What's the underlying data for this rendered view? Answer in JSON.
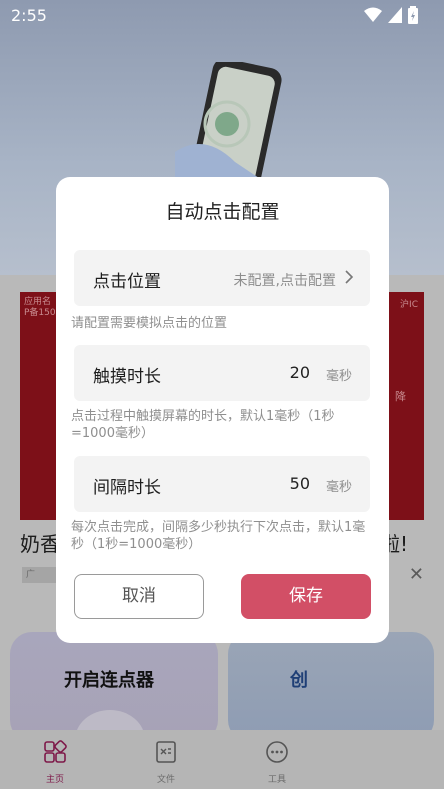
{
  "status_bar": {
    "time": "2:55"
  },
  "background": {
    "ad_small_left": "应用名\nP备150",
    "ad_small_right": "沪IC",
    "ad_right_text": "降",
    "headline_left": "奶香",
    "headline_right": "啦!",
    "ad_tag": "广",
    "card_left_title": "开启连点器",
    "card_right_title": "创"
  },
  "tabs": [
    {
      "label": "主页",
      "icon": "home-grid-icon",
      "active": true
    },
    {
      "label": "文件",
      "icon": "file-icon",
      "active": false
    },
    {
      "label": "工具",
      "icon": "more-dots-icon",
      "active": false
    }
  ],
  "dialog": {
    "title": "自动点击配置",
    "position_row": {
      "label": "点击位置",
      "value": "未配置,点击配置"
    },
    "position_hint": "请配置需要模拟点击的位置",
    "touch_row": {
      "label": "触摸时长",
      "value": "20",
      "unit": "毫秒"
    },
    "touch_hint": "点击过程中触摸屏幕的时长，默认1毫秒（1秒=1000毫秒）",
    "interval_row": {
      "label": "间隔时长",
      "value": "50",
      "unit": "毫秒"
    },
    "interval_hint": "每次点击完成，间隔多少秒执行下次点击，默认1毫秒（1秒=1000毫秒）",
    "cancel_label": "取消",
    "save_label": "保存"
  },
  "colors": {
    "accent": "#d24f66",
    "dialog_bg": "#ffffff",
    "row_bg": "#f3f3f3"
  }
}
